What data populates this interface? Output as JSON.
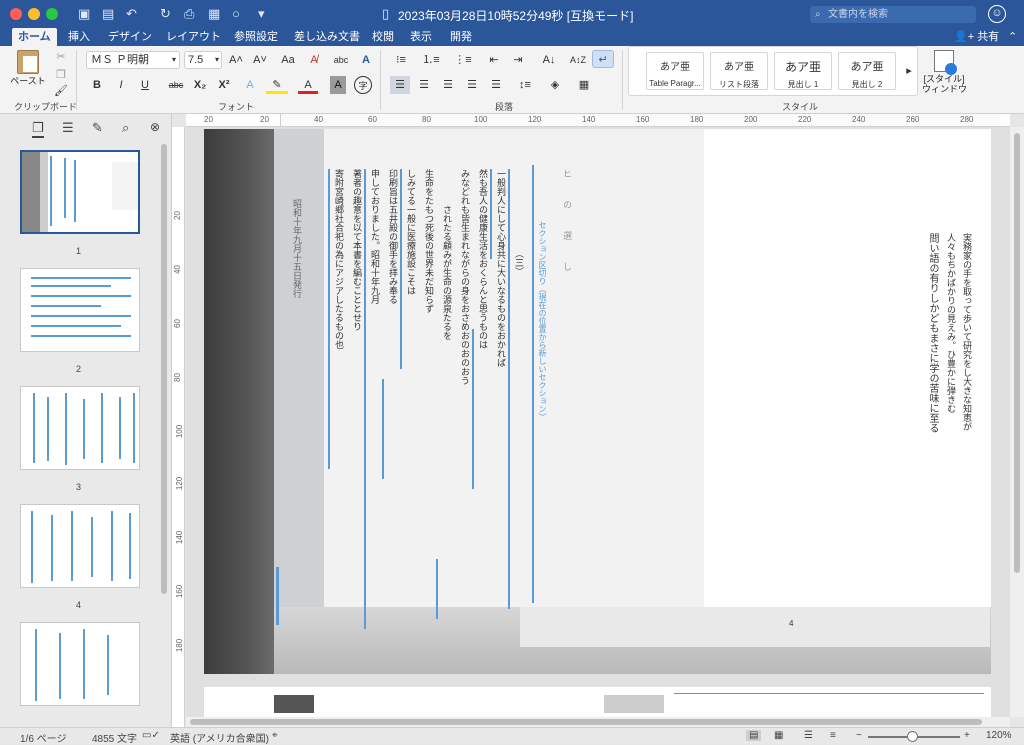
{
  "colors": {
    "accent": "#2b579a",
    "highlight": "#5b9bd5",
    "close": "#ff5f57",
    "minimize": "#febc2e",
    "maximize": "#28c840"
  },
  "window": {
    "title": "2023年03月28日10時52分49秒 [互換モード]",
    "search_placeholder": "文書内を検索",
    "account_icon": "smiley-icon"
  },
  "tabs": [
    "ホーム",
    "挿入",
    "デザイン",
    "レイアウト",
    "参照設定",
    "差し込み文書",
    "校閲",
    "表示",
    "開発"
  ],
  "share": {
    "label": "共有"
  },
  "ribbon": {
    "clipboard": {
      "paste": "ペースト",
      "group": "クリップボード"
    },
    "font": {
      "name": "ＭＳ Ｐ明朝",
      "size": "7.5",
      "group": "フォント",
      "bold": "B",
      "italic": "I",
      "underline": "U",
      "strike": "abc",
      "subscript": "X₂",
      "superscript": "X²"
    },
    "paragraph": {
      "group": "段落"
    },
    "styles": {
      "group": "スタイル",
      "items": [
        {
          "sample": "あア亜",
          "label": "Table Paragr..."
        },
        {
          "sample": "あア亜",
          "label": "リスト段落"
        },
        {
          "sample": "あア亜",
          "label": "見出し 1"
        },
        {
          "sample": "あア亜",
          "label": "見出し 2"
        }
      ],
      "pane": "[スタイル]\nウィンドウ"
    }
  },
  "nav": {
    "pages": [
      "1",
      "2",
      "3",
      "4"
    ]
  },
  "ruler": {
    "h": [
      "20",
      "20",
      "40",
      "60",
      "80",
      "100",
      "120",
      "140",
      "160",
      "180",
      "200",
      "220",
      "240",
      "260",
      "280"
    ],
    "v": [
      "20",
      "40",
      "60",
      "80",
      "100",
      "120",
      "140",
      "160",
      "180"
    ]
  },
  "doc": {
    "page_number": "4",
    "columns": [
      "実務家の手を取って歩いて研究をし大きな知恵が",
      "人々もちかばかりの見えみ。ひ豊かに弾きむ",
      "問い語の有りしかどもまさに学の苦味に至る",
      "ヒの選し",
      "セクション区切り（現在の位置から新しいセクション）",
      "（三）",
      "一般判人にして心身共に大いなるものをおかれば",
      "然も吾人の健康生活をおくらんと思うものは",
      "みなどれも皆生まれながらの身をおさめおのおのおう",
      "されたる顧みが生命の源泉たるを",
      "生命をたもつ死後の世界未だ知らず",
      "しみてる一般に医療施設こそは",
      "印刷旨は五井殿の御手を拝み奉る",
      "申しておりました。昭和十年九月",
      "著者の趣意を以て本書を編むこととせり",
      "寄附宮崎郷社合祀の為にアジアしたるもの也",
      "昭和十年九月十五日発行"
    ]
  },
  "status": {
    "page": "1/6 ページ",
    "words": "4855 文字",
    "language": "英語 (アメリカ合衆国)",
    "zoom": "120%"
  }
}
